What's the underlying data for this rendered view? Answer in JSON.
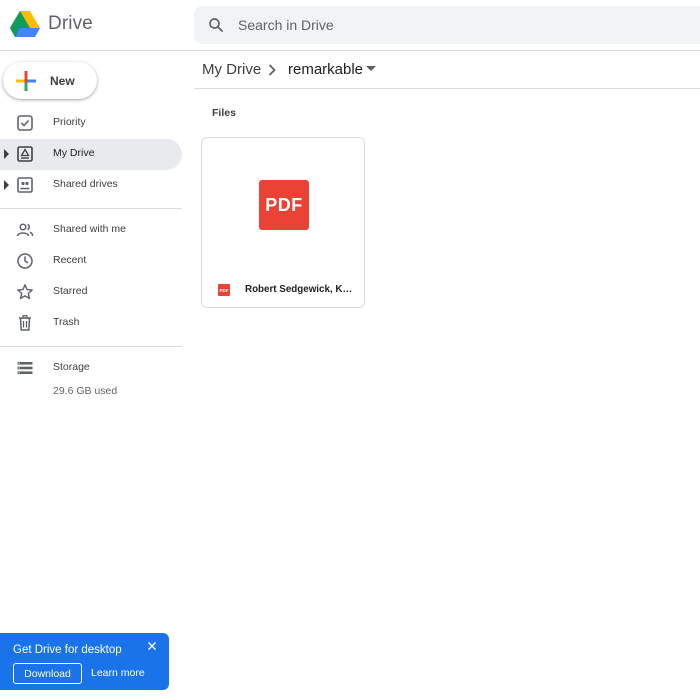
{
  "app": {
    "name": "Drive"
  },
  "search": {
    "placeholder": "Search in Drive",
    "value": ""
  },
  "sidebar": {
    "new_label": "New",
    "items": [
      {
        "label": "Priority",
        "icon": "priority-icon"
      },
      {
        "label": "My Drive",
        "icon": "my-drive-icon",
        "active": true
      },
      {
        "label": "Shared drives",
        "icon": "shared-drives-icon"
      },
      {
        "label": "Shared with me",
        "icon": "people-icon"
      },
      {
        "label": "Recent",
        "icon": "clock-icon"
      },
      {
        "label": "Starred",
        "icon": "star-icon"
      },
      {
        "label": "Trash",
        "icon": "trash-icon"
      },
      {
        "label": "Storage",
        "icon": "storage-icon"
      }
    ],
    "storage_used": "29.6 GB used"
  },
  "breadcrumb": {
    "root": "My Drive",
    "current": "remarkable"
  },
  "files": {
    "section_label": "Files",
    "items": [
      {
        "name": "Robert Sedgewick, Kevin Wayne - Algorithms",
        "type_label": "PDF",
        "mini_label": "PDF"
      }
    ]
  },
  "promo": {
    "title": "Get Drive for desktop",
    "download_label": "Download",
    "learn_more_label": "Learn more"
  },
  "colors": {
    "accent_blue": "#1a73e8",
    "pdf_red": "#ea4335",
    "active_bg": "#e8eaed",
    "search_bg": "#f1f3f4"
  }
}
